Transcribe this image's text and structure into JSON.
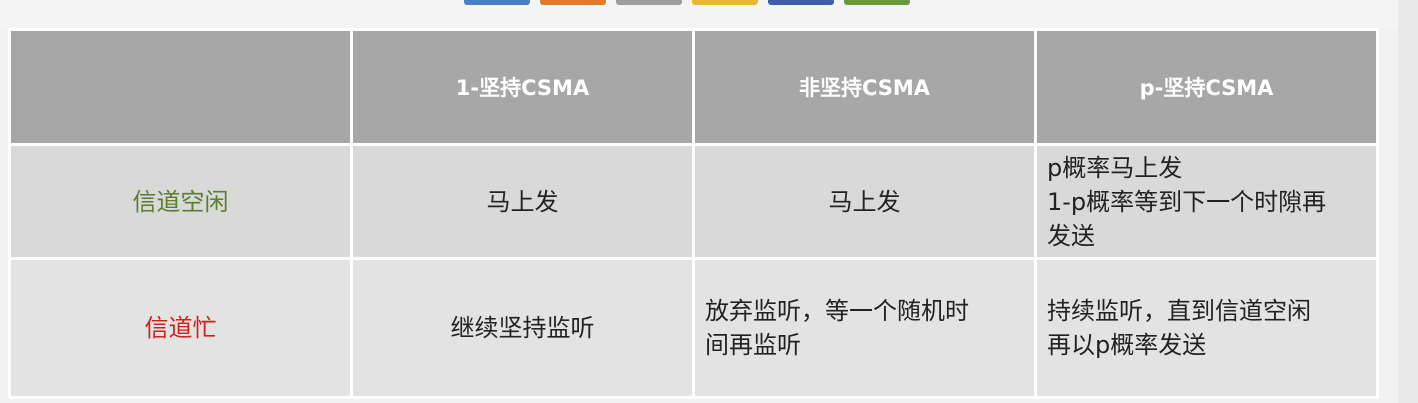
{
  "colors": {
    "header_bg": "#a7a7a7",
    "row_idle_bg": "#d9d9d9",
    "row_busy_bg": "#e3e3e3",
    "idle_label": "#5b7d2e",
    "busy_label": "#cc2222",
    "tab_colors": [
      "#4a7ec2",
      "#e07a2c",
      "#9d9d9d",
      "#e9b736",
      "#3e5fa8",
      "#6c9a3a"
    ]
  },
  "table": {
    "headers": [
      "",
      "1-坚持CSMA",
      "非坚持CSMA",
      "p-坚持CSMA"
    ],
    "rows": [
      {
        "label": "信道空闲",
        "cells": [
          [
            "马上发"
          ],
          [
            "马上发"
          ],
          [
            "p概率马上发",
            "1-p概率等到下一个时隙再",
            "发送"
          ]
        ]
      },
      {
        "label": "信道忙",
        "cells": [
          [
            "继续坚持监听"
          ],
          [
            "放弃监听，等一个随机时",
            "间再监听"
          ],
          [
            "持续监听，直到信道空闲",
            "再以p概率发送"
          ]
        ]
      }
    ]
  }
}
